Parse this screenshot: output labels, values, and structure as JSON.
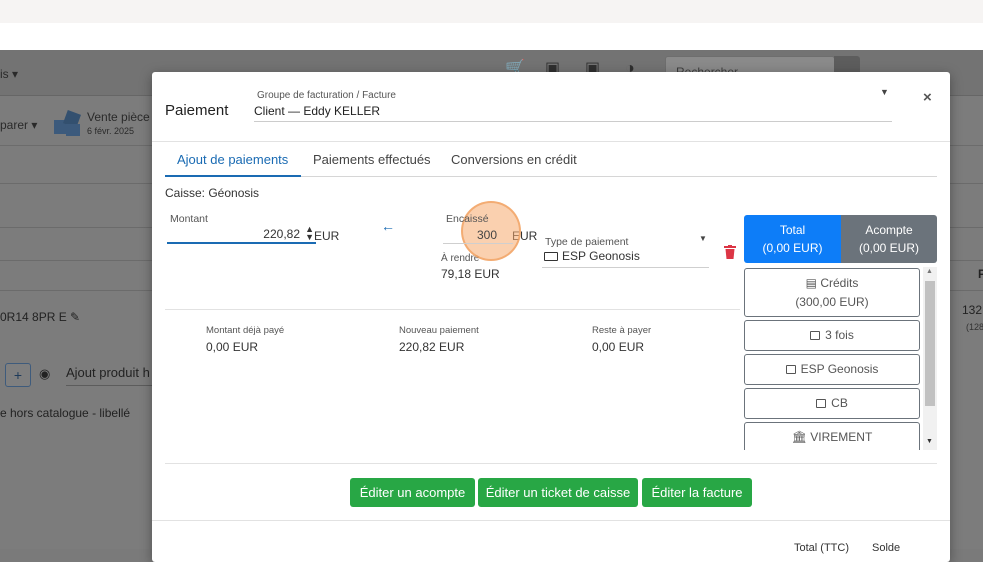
{
  "background": {
    "menu_dropdown": "is ▾",
    "search_placeholder": "Rechercher",
    "comparer": "parer ▾",
    "vente_title": "Vente pièce",
    "vente_date": "6 févr. 2025",
    "reference": "0R14 8PR E",
    "add_button": "+",
    "ajout_produit": "Ajout produit h",
    "hors_catalogue": "e hors catalogue - libellé",
    "right_header": "P",
    "right_value": "132",
    "right_sub": "(128"
  },
  "modal": {
    "title": "Paiement",
    "facture_label": "Groupe de facturation / Facture",
    "facture_value": "Client — Eddy KELLER",
    "close": "×",
    "tabs": [
      {
        "label": "Ajout de paiements",
        "active": true
      },
      {
        "label": "Paiements effectués",
        "active": false
      },
      {
        "label": "Conversions en crédit",
        "active": false
      }
    ],
    "caisse": "Caisse: Géonosis",
    "montant_label": "Montant",
    "montant_value": "220,82",
    "currency": "EUR",
    "encaisse_label": "Encaissé",
    "encaisse_value": "300",
    "rendre_label": "À rendre",
    "rendre_value": "79,18 EUR",
    "type_label": "Type de paiement",
    "type_value": "ESP Geonosis",
    "summary": [
      {
        "label": "Montant déjà payé",
        "value": "0,00 EUR"
      },
      {
        "label": "Nouveau paiement",
        "value": "220,82 EUR"
      },
      {
        "label": "Reste à payer",
        "value": "0,00 EUR"
      }
    ],
    "total_btn": {
      "label": "Total",
      "value": "(0,00 EUR)"
    },
    "acompte_btn": {
      "label": "Acompte",
      "value": "(0,00 EUR)"
    },
    "payment_methods": [
      {
        "label": "Crédits",
        "sub": "(300,00 EUR)"
      },
      {
        "label": "3 fois"
      },
      {
        "label": "ESP Geonosis"
      },
      {
        "label": "CB"
      },
      {
        "label": "VIREMENT"
      }
    ],
    "actions": {
      "edit_acompte": "Éditer un acompte",
      "edit_ticket": "Éditer un ticket de caisse",
      "edit_facture": "Éditer la facture"
    },
    "footer": {
      "total_ttc": "Total (TTC)",
      "solde": "Solde"
    }
  },
  "colors": {
    "primary": "#0d7df8",
    "secondary": "#6b737b",
    "success": "#28a745",
    "danger": "#dc3545",
    "tab_active": "#1a6bb3"
  }
}
